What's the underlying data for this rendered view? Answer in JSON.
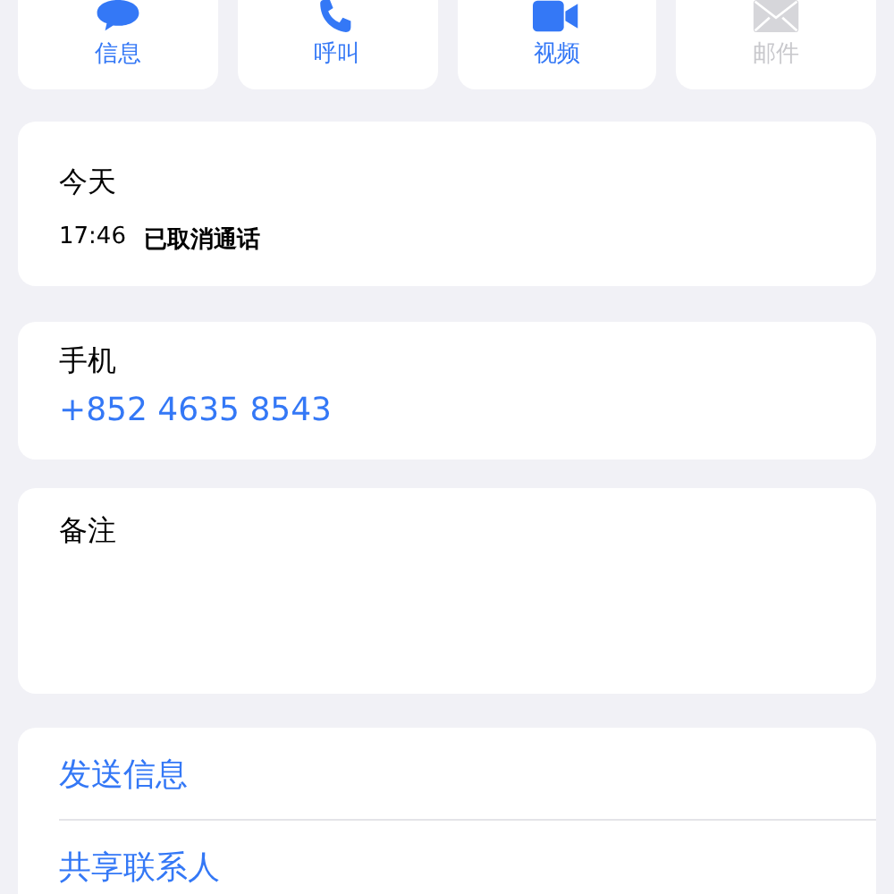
{
  "actions": [
    {
      "kind": "message",
      "label": "信息",
      "disabled": false
    },
    {
      "kind": "call",
      "label": "呼叫",
      "disabled": false
    },
    {
      "kind": "video",
      "label": "视频",
      "disabled": false
    },
    {
      "kind": "mail",
      "label": "邮件",
      "disabled": true
    }
  ],
  "recent": {
    "title": "今天",
    "time": "17:46",
    "status": "已取消通话"
  },
  "phone": {
    "label": "手机",
    "number": "+852 4635 8543"
  },
  "notes": {
    "label": "备注"
  },
  "links": [
    "发送信息",
    "共享联系人"
  ]
}
